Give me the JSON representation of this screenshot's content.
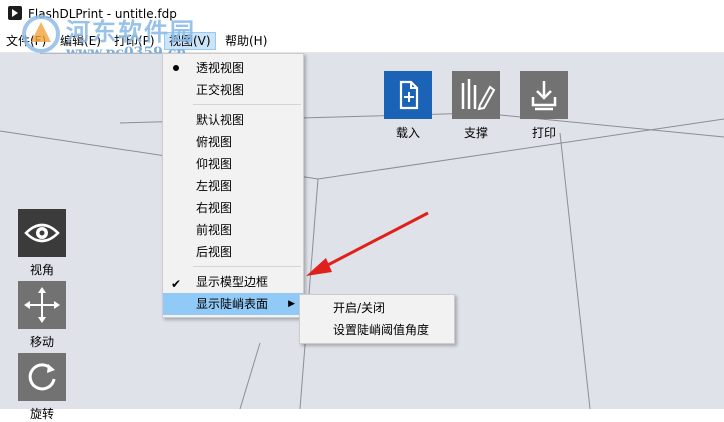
{
  "window": {
    "title": "FlashDLPrint - untitle.fdp"
  },
  "menubar": {
    "items": [
      {
        "label": "文件(F)"
      },
      {
        "label": "编辑(E)"
      },
      {
        "label": "打印(P)"
      },
      {
        "label": "视图(V)"
      },
      {
        "label": "帮助(H)"
      }
    ]
  },
  "watermark": {
    "line1": "河东软件园",
    "line2": "www.pc0359.cn"
  },
  "toolbar": {
    "load": {
      "label": "载入",
      "icon": "load-file-icon"
    },
    "support": {
      "label": "支撑",
      "icon": "support-edit-icon"
    },
    "print": {
      "label": "打印",
      "icon": "print-icon"
    }
  },
  "left_toolbar": {
    "view": {
      "label": "视角",
      "icon": "eye-icon"
    },
    "move": {
      "label": "移动",
      "icon": "move-arrows-icon"
    },
    "rotate": {
      "label": "旋转",
      "icon": "rotate-icon"
    }
  },
  "view_menu": {
    "perspective": "透视视图",
    "orthographic": "正交视图",
    "default_view": "默认视图",
    "top_view": "俯视图",
    "bottom_view": "仰视图",
    "left_view": "左视图",
    "right_view": "右视图",
    "front_view": "前视图",
    "back_view": "后视图",
    "show_model_border": "显示模型边框",
    "show_steep_surface": "显示陡峭表面"
  },
  "steep_submenu": {
    "toggle": "开启/关闭",
    "set_threshold": "设置陡峭阈值角度"
  },
  "colors": {
    "load_button": "#1a63b7",
    "tool_button": "#727272",
    "menu_highlight": "#91c9f7",
    "annotation_arrow": "#e0201c"
  }
}
